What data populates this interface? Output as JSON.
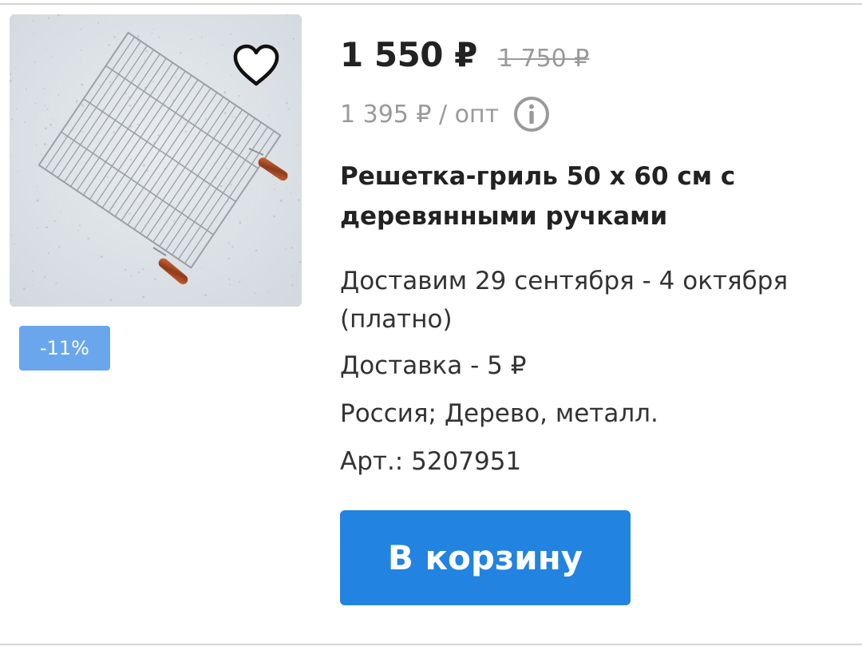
{
  "product": {
    "price_current": "1 550 ₽",
    "price_old": "1 750 ₽",
    "wholesale_price": "1 395 ₽ / опт",
    "discount": "-11%",
    "title": "Решетка-гриль 50 х 60 см с деревянными ручками",
    "delivery_dates": "Доставим 29 сентября - 4 октября (платно)",
    "delivery_cost": "Доставка - 5 ₽",
    "origin_material": "Россия; Дерево, металл.",
    "article": "Арт.: 5207951",
    "cart_button_label": "В корзину"
  },
  "icons": {
    "favorite": "heart-outline-icon",
    "info": "info-circle-icon"
  },
  "colors": {
    "accent": "#2283e0",
    "discount_badge": "#6aa6ec",
    "muted_text": "#9a9a9a",
    "photo_background": "#dde2e7",
    "handle": "#b5522a"
  }
}
